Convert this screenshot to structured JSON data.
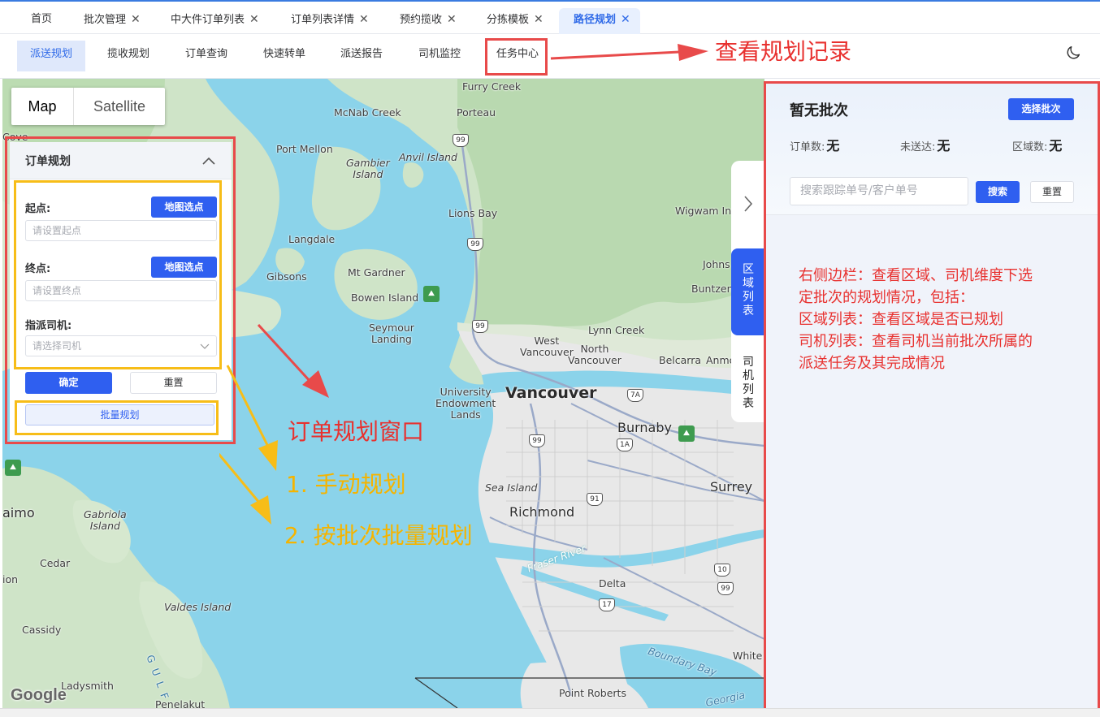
{
  "tabs": [
    {
      "label": "首页",
      "closable": false
    },
    {
      "label": "批次管理",
      "closable": true
    },
    {
      "label": "中大件订单列表",
      "closable": true
    },
    {
      "label": "订单列表详情",
      "closable": true
    },
    {
      "label": "预约揽收",
      "closable": true
    },
    {
      "label": "分拣模板",
      "closable": true
    },
    {
      "label": "路径规划",
      "closable": true,
      "active": true
    }
  ],
  "subnav": [
    "派送规划",
    "揽收规划",
    "订单查询",
    "快速转单",
    "派送报告",
    "司机监控",
    "任务中心"
  ],
  "map": {
    "type_map": "Map",
    "type_satellite": "Satellite",
    "logo": "Google",
    "labels": {
      "furry_creek": "Furry Creek",
      "mcnab_creek": "McNab Creek",
      "porteau": "Porteau",
      "cove": "Cove",
      "port_mellon": "Port Mellon",
      "gambier_island": "Gambier\nIsland",
      "anvil_island": "Anvil Island",
      "lions_bay": "Lions Bay",
      "wigwam_inn": "Wigwam Inn",
      "langdale": "Langdale",
      "gibsons": "Gibsons",
      "mt_gardner": "Mt Gardner",
      "bowen_island": "Bowen Island",
      "johns": "Johns",
      "buntzen": "Buntzen",
      "seymour_landing": "Seymour\nLanding",
      "lynn_creek": "Lynn Creek",
      "west_vancouver": "West\nVancouver",
      "north_vancouver": "North\nVancouver",
      "belcarra": "Belcarra",
      "anmore": "Anmo",
      "ubc": "University\nEndowment\nLands",
      "vancouver": "Vancouver",
      "burnaby": "Burnaby",
      "sea_island": "Sea Island",
      "richmond": "Richmond",
      "surrey": "Surrey",
      "fraser_river": "Fraser River",
      "delta": "Delta",
      "nanaimo": "aimo",
      "gabriola": "Gabriola\nIsland",
      "cedar": "Cedar",
      "ion": "ion",
      "valdes": "Valdes Island",
      "cassidy": "Cassidy",
      "ladysmith": "Ladysmith",
      "gulf": "G U L F",
      "boundary_bay": "Boundary Bay",
      "white_rock": "White",
      "point_roberts": "Point Roberts",
      "penelakut": "Penelakut",
      "georgia": "Georgia"
    },
    "shields": {
      "s99a": "99",
      "s99b": "99",
      "s99c": "99",
      "s7a": "7A",
      "s1": "1",
      "s1a": "1A",
      "s99d": "99",
      "s91": "91",
      "s10": "10",
      "s99e": "99",
      "s17": "17"
    }
  },
  "order_panel": {
    "title": "订单规划",
    "start_label": "起点:",
    "start_pick": "地图选点",
    "start_placeholder": "请设置起点",
    "end_label": "终点:",
    "end_pick": "地图选点",
    "end_placeholder": "请设置终点",
    "driver_label": "指派司机:",
    "driver_placeholder": "请选择司机",
    "confirm": "确定",
    "reset": "重置",
    "batch": "批量规划"
  },
  "side_tabs": {
    "region": [
      "区",
      "域",
      "列",
      "表"
    ],
    "driver": [
      "司",
      "机",
      "列",
      "表"
    ]
  },
  "right_panel": {
    "title": "暂无批次",
    "select_batch": "选择批次",
    "orders_label": "订单数:",
    "orders_value": "无",
    "undelivered_label": "未送达:",
    "undelivered_value": "无",
    "regions_label": "区域数:",
    "regions_value": "无",
    "search_placeholder": "搜索跟踪单号/客户单号",
    "search": "搜索",
    "reset": "重置"
  },
  "annotations": {
    "task_center": "查看规划记录",
    "order_window": "订单规划窗口",
    "manual": "1. 手动规划",
    "batch_plan": "2. 按批次批量规划",
    "sidebar_note": [
      "右侧边栏：查看区域、司机维度下选",
      "定批次的规划情况，包括：",
      "区域列表：查看区域是否已规划",
      "司机列表：查看司机当前批次所属的",
      "派送任务及其完成情况"
    ]
  },
  "colors": {
    "primary": "#2f5ff0",
    "annotation_red": "#e8312f",
    "annotation_yellow": "#f5b400",
    "water": "#8bd3ea"
  }
}
